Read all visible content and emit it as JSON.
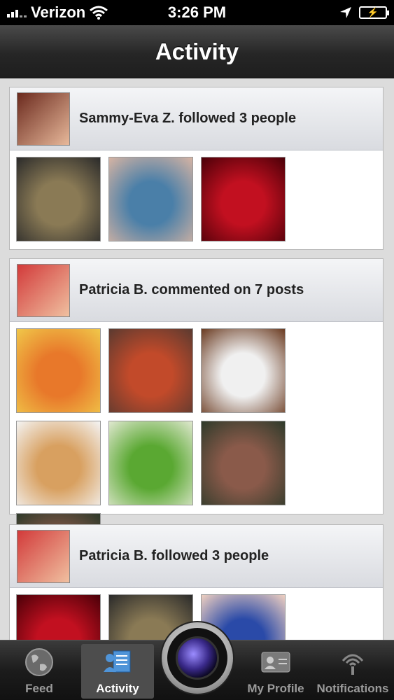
{
  "status_bar": {
    "carrier": "Verizon",
    "time": "3:26 PM"
  },
  "nav": {
    "title": "Activity"
  },
  "cards": [
    {
      "title": "Sammy-Eva Z. followed 3 people",
      "avatar_colors": [
        "#6b2a1e",
        "#e7b89a"
      ],
      "thumbs": [
        [
          "#8a7a55",
          "#2a2a2a"
        ],
        [
          "#4a7fa8",
          "#d7b4a3"
        ],
        [
          "#c21020",
          "#4a0008"
        ]
      ]
    },
    {
      "title": "Patricia B. commented on 7 posts",
      "avatar_colors": [
        "#d23a3a",
        "#f0c0a0"
      ],
      "thumbs": [
        [
          "#e8782a",
          "#f0c84a"
        ],
        [
          "#c24a2a",
          "#5a3a30"
        ],
        [
          "#f0f0f0",
          "#6a3a20"
        ],
        [
          "#d8a060",
          "#f4f4f4"
        ],
        [
          "#5aa832",
          "#e0e8d0"
        ],
        [
          "#8a5a4a",
          "#2e3a2a"
        ],
        [
          "#8a5a4a",
          "#2e3a2a"
        ]
      ]
    },
    {
      "title": "Patricia B. followed 3 people",
      "avatar_colors": [
        "#d23a3a",
        "#f0c0a0"
      ],
      "thumbs": [
        [
          "#c21020",
          "#4a0008"
        ],
        [
          "#8a7a55",
          "#2a2a2a"
        ],
        [
          "#2a4aa8",
          "#f0d0c0"
        ]
      ]
    }
  ],
  "tabs": [
    {
      "label": "Feed",
      "icon": "globe-icon"
    },
    {
      "label": "Activity",
      "icon": "activity-icon"
    },
    {
      "label": "My Profile",
      "icon": "profile-card-icon"
    },
    {
      "label": "Notifications",
      "icon": "broadcast-icon"
    }
  ],
  "colors": {
    "nav_bg": "#262626",
    "card_head": "#e2e4e8",
    "active_tab": "#4d4d4d"
  }
}
